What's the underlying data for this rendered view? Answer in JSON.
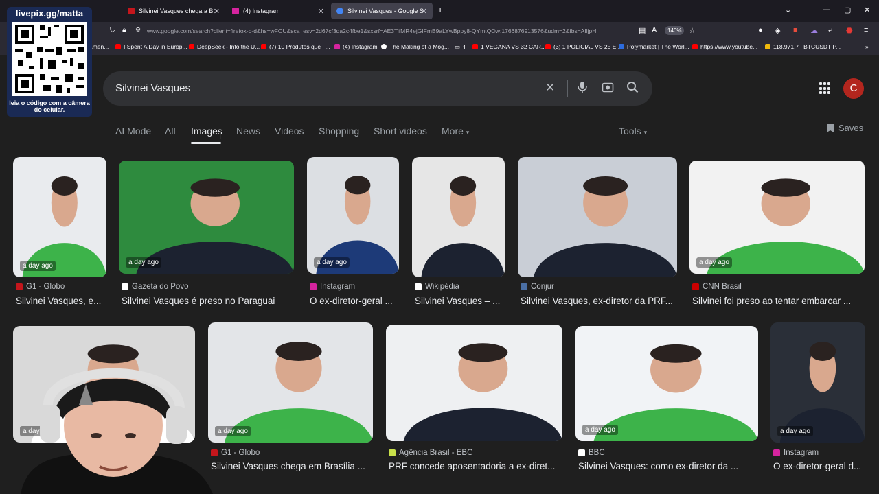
{
  "browser": {
    "tabs": [
      {
        "title": "Silvinei Vasques chega a Brasília",
        "favicon_color": "#c4161c"
      },
      {
        "title": "(4) Instagram",
        "favicon_color": "#d6249f"
      },
      {
        "title": "Silvinei Vasques - Google Search",
        "favicon_color": "#4285f4"
      }
    ],
    "new_tab": "+",
    "url": "www.google.com/search?client=firefox-b-d&hs=wFOU&sca_esv=2d67cf3da2c4fbe1&sxsrf=AE3TifMR4ejGIFmB9aLYwBppy8-QYmtQOw:1766876913576&udm=2&fbs=AIljpH",
    "zoom": "140%",
    "bookmarks": [
      {
        "label": "amen...",
        "color": "#888"
      },
      {
        "label": "I Spent A Day in Europ...",
        "color": "#ff0000"
      },
      {
        "label": "DeepSeek - Into the U...",
        "color": "#ff0000"
      },
      {
        "label": "(7) 10 Produtos que F...",
        "color": "#ff0000"
      },
      {
        "label": "(4) Instagram",
        "color": "#d6249f"
      },
      {
        "label": "The Making of a Mog...",
        "color": "#ffffff"
      },
      {
        "label": "1",
        "color": "#888"
      },
      {
        "label": "1 VEGANA VS 32 CAR...",
        "color": "#ff0000"
      },
      {
        "label": "(3) 1 POLICIAL VS 25 E...",
        "color": "#ff0000"
      },
      {
        "label": "Polymarket | The Worl...",
        "color": "#2d6cdf"
      },
      {
        "label": "https://www.youtube...",
        "color": "#ff0000"
      },
      {
        "label": "118,971.7 | BTCUSDT P...",
        "color": "#f0b90b"
      }
    ]
  },
  "overlay": {
    "qr_title": "livepix.gg/matta",
    "qr_caption": "leia o código com a câmera do celular."
  },
  "search": {
    "query": "Silvinei Vasques",
    "avatar_letter": "C",
    "tabs": [
      "AI Mode",
      "All",
      "Images",
      "News",
      "Videos",
      "Shopping",
      "Short videos",
      "More"
    ],
    "active_tab": "Images",
    "tools": "Tools",
    "saves": "Saves"
  },
  "results_row1": [
    {
      "age": "a day ago",
      "source": "G1 - Globo",
      "caption": "Silvinei Vasques, e...",
      "fav": "#c4161c",
      "bg": "#e9ebee",
      "shirt": "#3db34a"
    },
    {
      "age": "a day ago",
      "source": "Gazeta do Povo",
      "caption": "Silvinei Vasques é preso no Paraguai",
      "fav": "#ffffff",
      "bg": "#2e8b3e",
      "shirt": "#1c2230"
    },
    {
      "age": "a day ago",
      "source": "Instagram",
      "caption": "O ex-diretor-geral ...",
      "fav": "#d6249f",
      "bg": "#dcdfe3",
      "shirt": "#1d3a78"
    },
    {
      "age": "",
      "source": "Wikipédia",
      "caption": "Silvinei Vasques – ...",
      "fav": "#ffffff",
      "bg": "#e6e6e6",
      "shirt": "#1c2230"
    },
    {
      "age": "",
      "source": "Conjur",
      "caption": "Silvinei Vasques, ex-diretor da PRF...",
      "fav": "#4a6fa5",
      "bg": "#c9ced6",
      "shirt": "#1c2230"
    },
    {
      "age": "a day ago",
      "source": "CNN Brasil",
      "caption": "Silvinei foi preso ao tentar embarcar ...",
      "fav": "#cc0000",
      "bg": "#f2f2f2",
      "shirt": "#3db34a"
    }
  ],
  "results_row2": [
    {
      "age": "a day ago",
      "source": "",
      "caption": "",
      "fav": "#c4161c",
      "bg": "#d9d9d9",
      "shirt": "#ffffff"
    },
    {
      "age": "a day ago",
      "source": "G1 - Globo",
      "caption": "Silvinei Vasques chega em Brasília ...",
      "fav": "#c4161c",
      "bg": "#e3e5e8",
      "shirt": "#3db34a"
    },
    {
      "age": "",
      "source": "Agência Brasil - EBC",
      "caption": "PRF concede aposentadoria a ex-diret...",
      "fav": "#c8e04a",
      "bg": "#eef0f2",
      "shirt": "#1c2230"
    },
    {
      "age": "a day ago",
      "source": "BBC",
      "caption": "Silvinei Vasques: como ex-diretor da ...",
      "fav": "#ffffff",
      "bg": "#f1f3f6",
      "shirt": "#3db34a"
    },
    {
      "age": "a day ago",
      "source": "Instagram",
      "caption": "O ex-diretor-geral d...",
      "fav": "#d6249f",
      "bg": "#2a2f38",
      "shirt": "#1c2230"
    }
  ]
}
